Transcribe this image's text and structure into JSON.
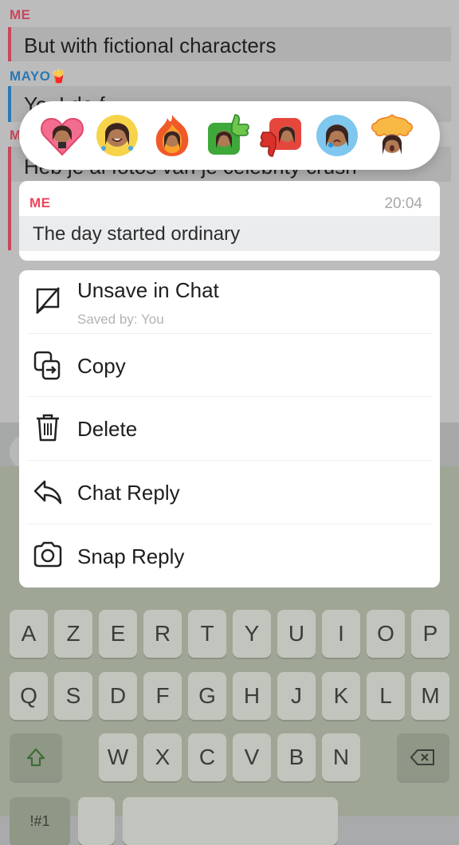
{
  "chat": {
    "messages": [
      {
        "sender": "ME",
        "text": "But with fictional characters",
        "color": "#e5405a"
      },
      {
        "sender": "MAYO",
        "sender_emoji": "🍟",
        "text": "Yo, I do f",
        "color": "#1f87d0"
      },
      {
        "sender": "ME",
        "text": "Heb je al fotos van je celebrity crush",
        "color": "#e5405a"
      }
    ]
  },
  "reactions": [
    {
      "icon": "bitmoji-heart-icon"
    },
    {
      "icon": "bitmoji-laughing-tears-icon"
    },
    {
      "icon": "bitmoji-fire-icon"
    },
    {
      "icon": "bitmoji-thumbs-up-icon"
    },
    {
      "icon": "bitmoji-thumbs-down-icon"
    },
    {
      "icon": "bitmoji-crying-icon"
    },
    {
      "icon": "bitmoji-mind-blown-icon"
    }
  ],
  "preview": {
    "sender": "ME",
    "time": "20:04",
    "text": "The day started ordinary"
  },
  "menu": {
    "items": [
      {
        "label": "Unsave in Chat",
        "sub": "Saved by: You",
        "icon": "unsave-icon"
      },
      {
        "label": "Copy",
        "icon": "copy-icon"
      },
      {
        "label": "Delete",
        "icon": "trash-icon"
      },
      {
        "label": "Chat Reply",
        "icon": "reply-arrow-icon"
      },
      {
        "label": "Snap Reply",
        "icon": "camera-icon"
      }
    ]
  },
  "keyboard": {
    "row1": [
      "A",
      "Z",
      "E",
      "R",
      "T",
      "Y",
      "U",
      "I",
      "O",
      "P"
    ],
    "row2": [
      "Q",
      "S",
      "D",
      "F",
      "G",
      "H",
      "J",
      "K",
      "L",
      "M"
    ],
    "row3": [
      "W",
      "X",
      "C",
      "V",
      "B",
      "N"
    ],
    "bottom_partial": "!#1"
  },
  "colors": {
    "accent_me": "#f0455a",
    "accent_friend": "#1f87d0"
  }
}
